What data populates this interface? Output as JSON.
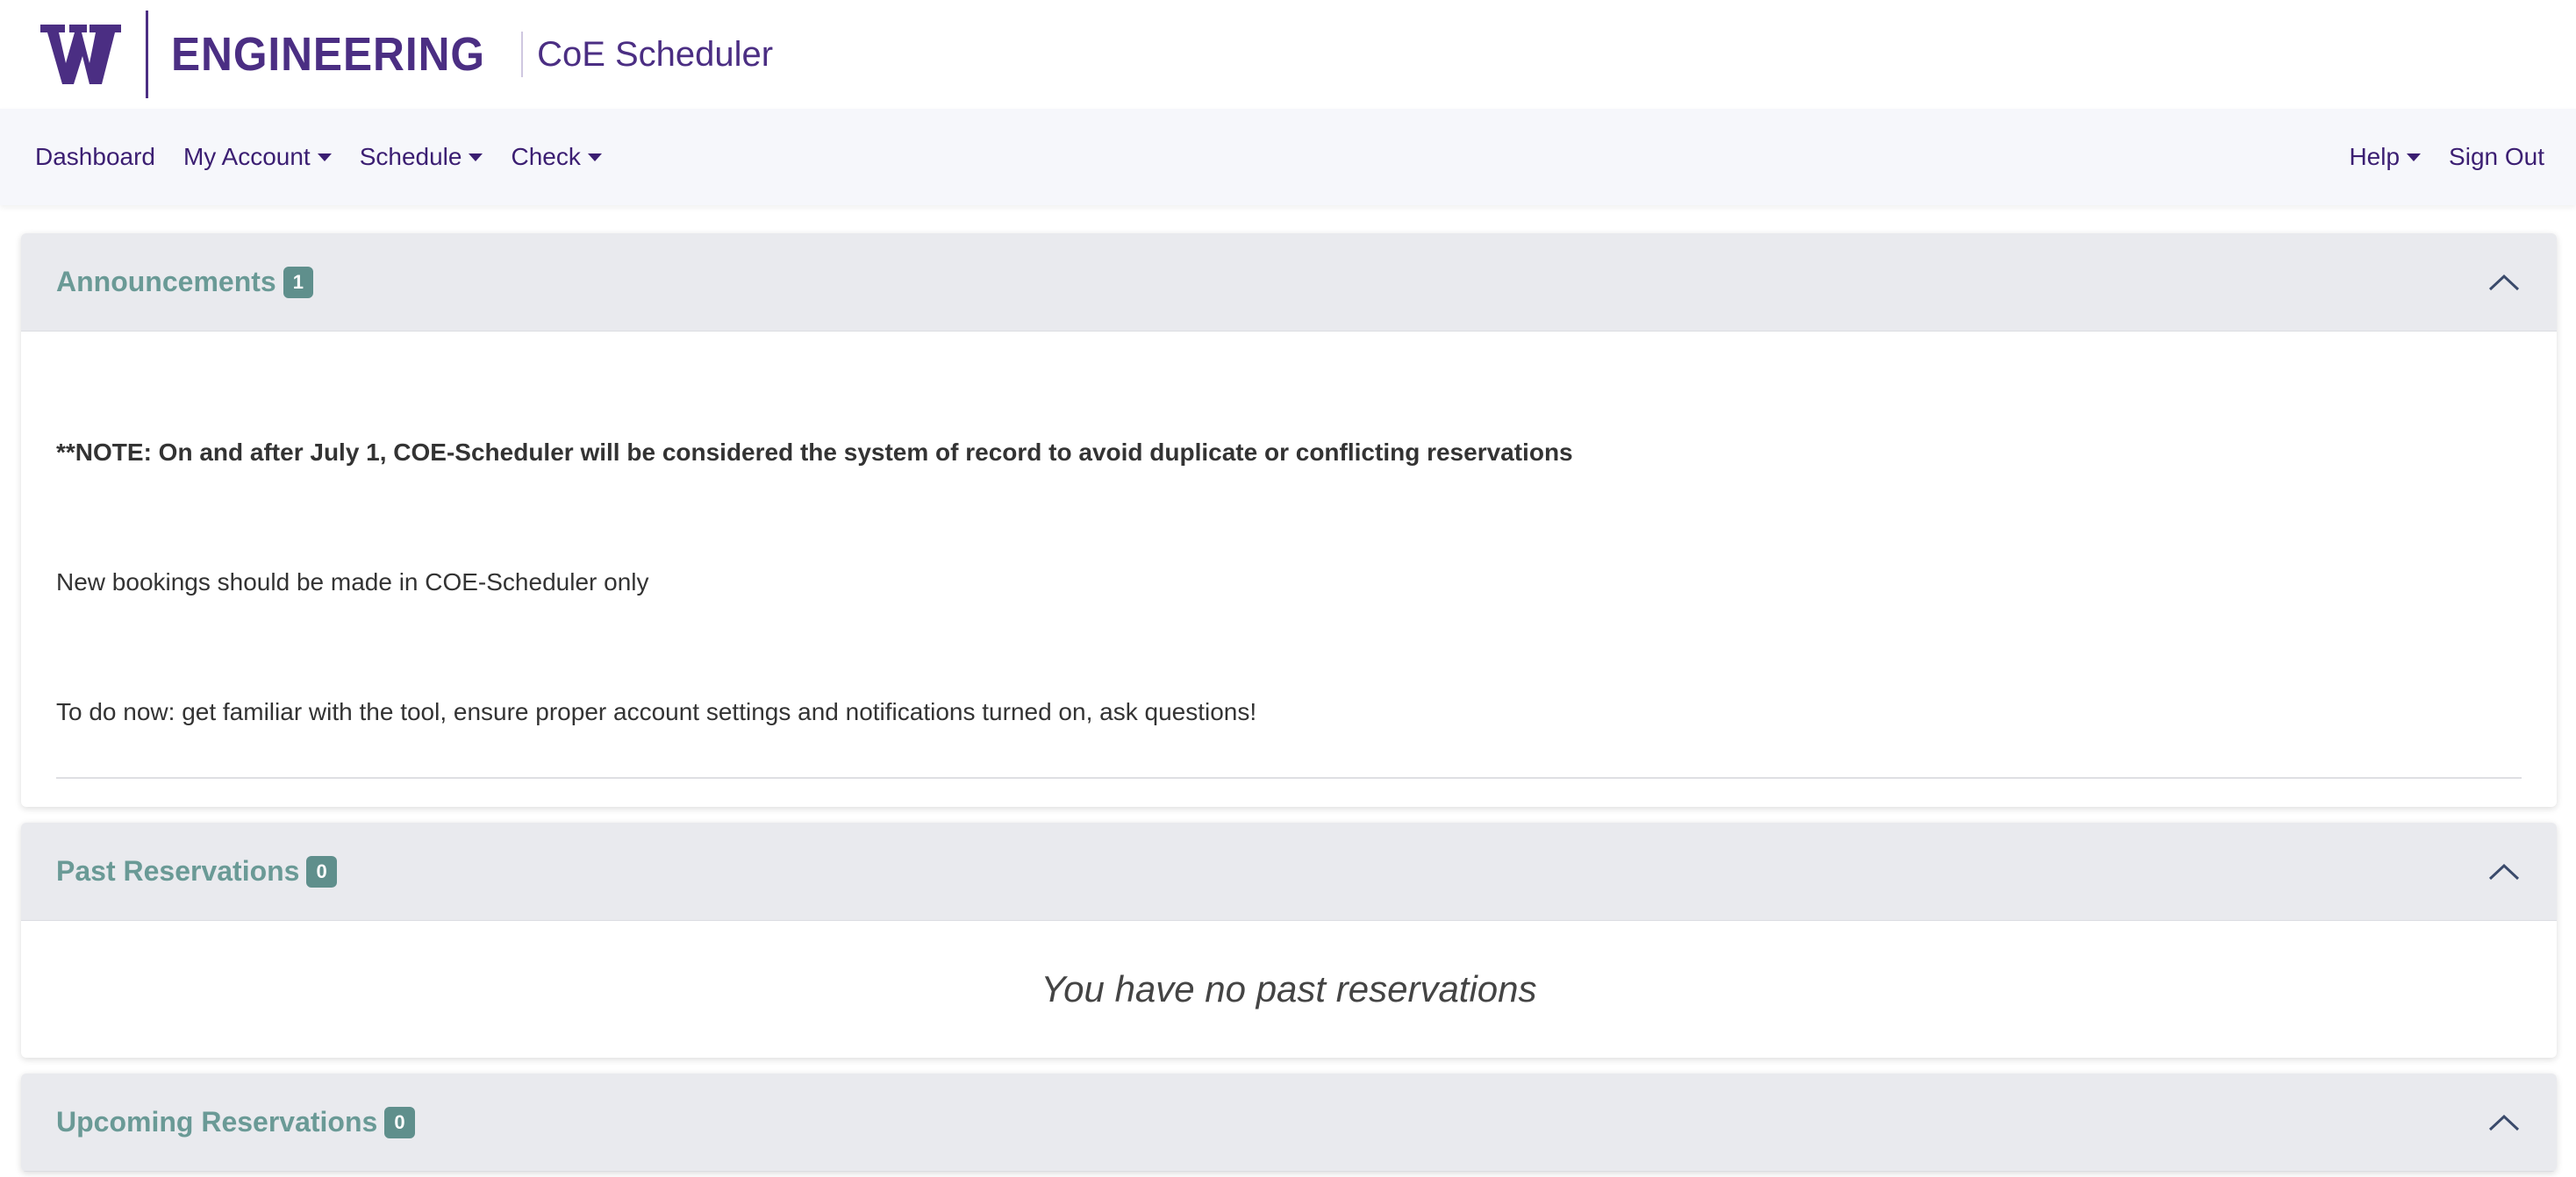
{
  "brand": {
    "logo_letter": "W",
    "org": "ENGINEERING",
    "app_name": "CoE Scheduler",
    "color": "#4b2e83"
  },
  "nav": {
    "left": [
      {
        "label": "Dashboard",
        "dropdown": false
      },
      {
        "label": "My Account",
        "dropdown": true
      },
      {
        "label": "Schedule",
        "dropdown": true
      },
      {
        "label": "Check",
        "dropdown": true
      }
    ],
    "right": [
      {
        "label": "Help",
        "dropdown": true
      },
      {
        "label": "Sign Out",
        "dropdown": false
      }
    ]
  },
  "announcements": {
    "title": "Announcements",
    "count": "1",
    "lines": [
      "**NOTE: On and after July 1, COE-Scheduler will be considered the system of record to avoid duplicate or conflicting reservations",
      "New bookings should be made in COE-Scheduler only",
      "To do now: get familiar with the tool, ensure proper account settings and notifications turned on, ask questions!"
    ]
  },
  "past_reservations": {
    "title": "Past Reservations",
    "count": "0",
    "empty_message": "You have no past reservations"
  },
  "upcoming_reservations": {
    "title": "Upcoming Reservations",
    "count": "0"
  },
  "colors": {
    "header_bg": "#e9eaee",
    "title_text": "#6a9a96",
    "badge_bg": "#5f8f8c",
    "nav_bg": "#f6f7fb"
  }
}
